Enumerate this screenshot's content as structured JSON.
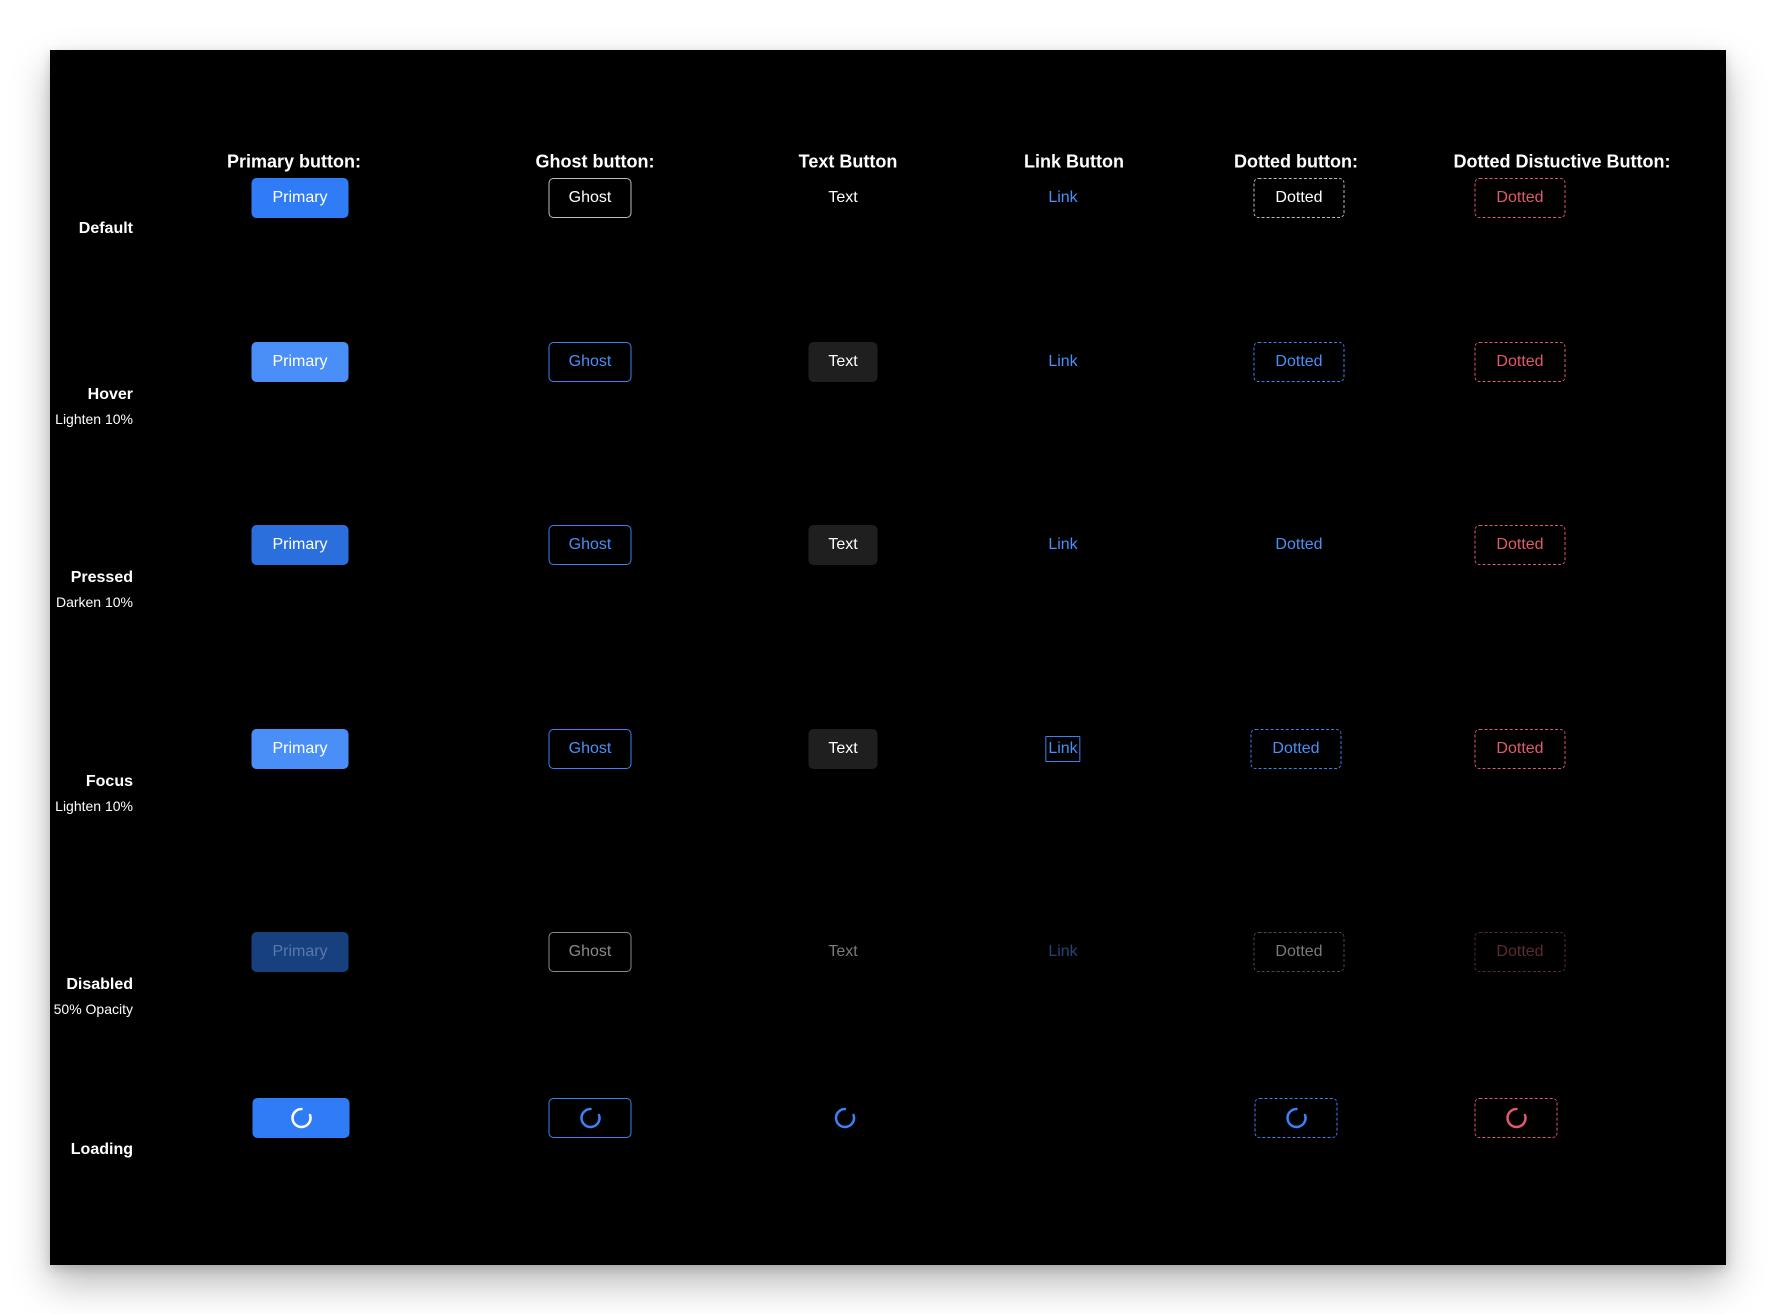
{
  "columns": [
    {
      "id": "primary",
      "header": "Primary button:"
    },
    {
      "id": "ghost",
      "header": "Ghost button:"
    },
    {
      "id": "text",
      "header": "Text Button"
    },
    {
      "id": "link",
      "header": "Link Button"
    },
    {
      "id": "dotted",
      "header": "Dotted button:"
    },
    {
      "id": "destructive",
      "header": "Dotted Distuctive Button:"
    }
  ],
  "rows": {
    "default": {
      "title": "Default",
      "subtitle": ""
    },
    "hover": {
      "title": "Hover",
      "subtitle": "Lighten 10%"
    },
    "pressed": {
      "title": "Pressed",
      "subtitle": "Darken 10%"
    },
    "focus": {
      "title": "Focus",
      "subtitle": "Lighten 10%"
    },
    "disabled": {
      "title": "Disabled",
      "subtitle": "50% Opacity"
    },
    "loading": {
      "title": "Loading",
      "subtitle": ""
    }
  },
  "labels": {
    "primary": "Primary",
    "ghost": "Ghost",
    "text": "Text",
    "link": "Link",
    "dotted": "Dotted"
  },
  "colors": {
    "background": "#000000",
    "primary_blue": "#2f7cf6",
    "accent_blue": "#4a8ff8",
    "destructive_red": "#e05a6b",
    "text_hover_bg": "#1f1f1f"
  },
  "icons": {
    "loading": "spinner-icon"
  }
}
